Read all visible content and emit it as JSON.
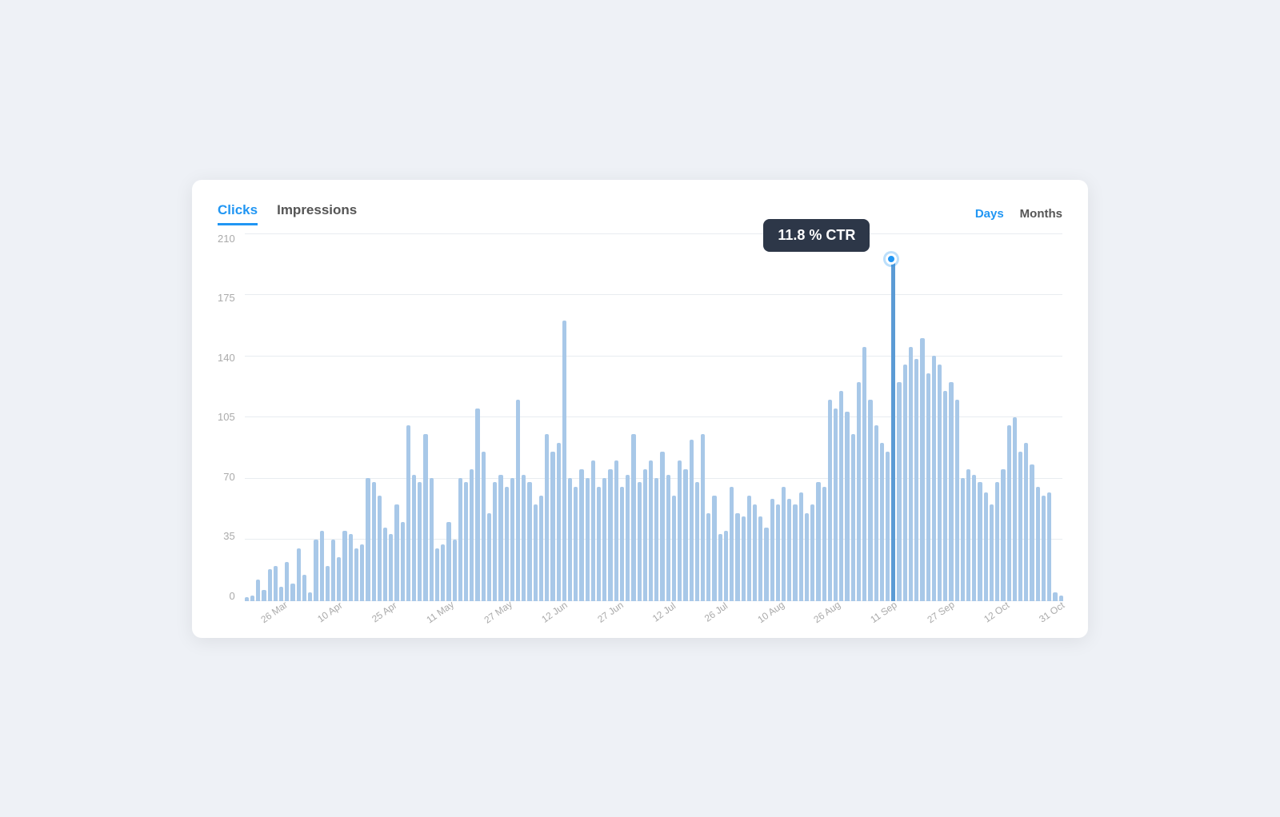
{
  "tabs_left": [
    {
      "label": "Clicks",
      "active": true
    },
    {
      "label": "Impressions",
      "active": false
    }
  ],
  "tabs_right": [
    {
      "label": "Days",
      "active": true
    },
    {
      "label": "Months",
      "active": false
    }
  ],
  "tooltip": {
    "text": "11.8 % CTR"
  },
  "y_axis_labels": [
    "210",
    "175",
    "140",
    "105",
    "70",
    "35",
    "0"
  ],
  "x_axis_labels": [
    "26 Mar",
    "10 Apr",
    "25 Apr",
    "11 May",
    "27 May",
    "12 Jun",
    "27 Jun",
    "12 Jul",
    "26 Jul",
    "10 Aug",
    "26 Aug",
    "11 Sep",
    "27 Sep",
    "12 Oct",
    "31 Oct"
  ],
  "bars": [
    2,
    3,
    12,
    6,
    18,
    20,
    8,
    22,
    10,
    30,
    15,
    5,
    35,
    40,
    20,
    35,
    25,
    40,
    38,
    30,
    32,
    70,
    68,
    60,
    42,
    38,
    55,
    45,
    100,
    72,
    68,
    95,
    70,
    30,
    32,
    45,
    35,
    70,
    68,
    75,
    110,
    85,
    50,
    68,
    72,
    65,
    70,
    115,
    72,
    68,
    55,
    60,
    95,
    85,
    90,
    160,
    70,
    65,
    75,
    70,
    80,
    65,
    70,
    75,
    80,
    65,
    72,
    95,
    68,
    75,
    80,
    70,
    85,
    72,
    60,
    80,
    75,
    92,
    68,
    95,
    50,
    60,
    38,
    40,
    65,
    50,
    48,
    60,
    55,
    48,
    42,
    58,
    55,
    65,
    58,
    55,
    62,
    50,
    55,
    68,
    65,
    115,
    110,
    120,
    108,
    95,
    125,
    145,
    115,
    100,
    90,
    85,
    195,
    125,
    135,
    145,
    138,
    150,
    130,
    140,
    135,
    120,
    125,
    115,
    70,
    75,
    72,
    68,
    62,
    55,
    68,
    75,
    100,
    105,
    85,
    90,
    78,
    65,
    60,
    62,
    5,
    3
  ],
  "colors": {
    "bar_normal": "#a8c8e8",
    "bar_highlighted": "#5b9bd5",
    "tooltip_bg": "#2d3748",
    "tab_active": "#2196f3",
    "tab_inactive": "#555555",
    "grid_line": "#e8ecf0"
  }
}
